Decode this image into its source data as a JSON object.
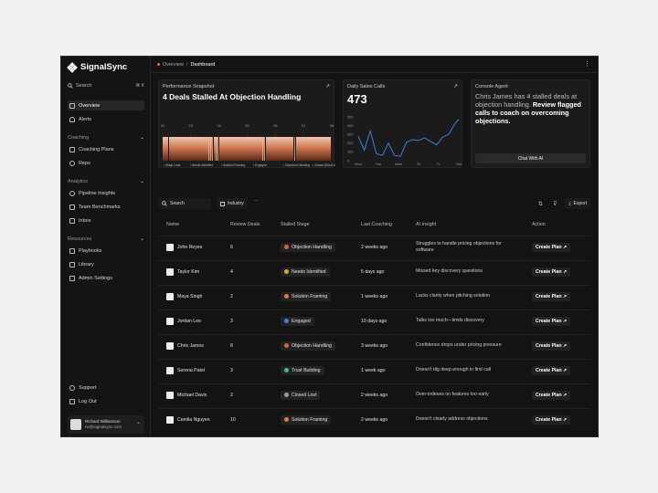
{
  "app": {
    "name": "SignalSync"
  },
  "sidebar": {
    "search_label": "Search",
    "search_shortcut": "⌘ K",
    "main_items": [
      {
        "label": "Overview",
        "icon": "home-icon",
        "active": true
      },
      {
        "label": "Alerts",
        "icon": "bell-icon",
        "active": false
      }
    ],
    "sections": [
      {
        "title": "Coaching",
        "items": [
          {
            "label": "Coaching Plans",
            "icon": "calendar-icon"
          },
          {
            "label": "Reps",
            "icon": "users-icon"
          }
        ]
      },
      {
        "title": "Analytics",
        "items": [
          {
            "label": "Pipeline Insights",
            "icon": "pipeline-icon"
          },
          {
            "label": "Team Benchmarks",
            "icon": "benchmark-icon"
          },
          {
            "label": "Inbox",
            "icon": "inbox-icon"
          }
        ]
      },
      {
        "title": "Resources",
        "items": [
          {
            "label": "Playbooks",
            "icon": "book-icon"
          },
          {
            "label": "Library",
            "icon": "library-icon"
          },
          {
            "label": "Admin Settings",
            "icon": "settings-icon"
          }
        ]
      }
    ],
    "footer_items": [
      {
        "label": "Support",
        "icon": "help-icon"
      },
      {
        "label": "Log Out",
        "icon": "logout-icon"
      }
    ],
    "user": {
      "name": "Richard Williamson",
      "email": "rw@signalsync.com"
    }
  },
  "breadcrumb": {
    "parent": "Overview",
    "separator": "/",
    "current": "Dashboard"
  },
  "performance": {
    "title": "Performance Snapshot",
    "headline": "4 Deals Stalled At Objection Handling",
    "axis_ticks": [
      "02",
      "03",
      "04",
      "05",
      "06",
      "07",
      "08"
    ],
    "stage_labels": [
      "Stage Lead",
      "Needs Identified",
      "Solution Framing",
      "Engaged",
      "Objection Handling",
      "Closed (Won/Lost)"
    ],
    "accent": "#c9714a"
  },
  "daily_calls": {
    "title": "Daily Sales Calls",
    "value": "473",
    "line_color": "#3d7fe0"
  },
  "agent": {
    "title": "Console Agent",
    "text_plain": "Chris James has 4 stalled deals at objection handling. ",
    "text_bold": "Review flagged calls to coach on overcoming objections.",
    "button": "Chat With AI"
  },
  "toolbar": {
    "search": "Search",
    "industry": "Industry",
    "export": "Export"
  },
  "table": {
    "headers": {
      "name": "Name",
      "deals": "Review Deals",
      "stage": "Stalled Stage",
      "coaching": "Last Coaching",
      "insight": "AI Insight",
      "action": "Action"
    },
    "rows": [
      {
        "name": "John Reyes",
        "deals": "6",
        "stage": "Objection Handling",
        "stage_color": "#e0603a",
        "coaching": "2 weeks ago",
        "insight": "Struggles to handle pricing objections for software",
        "action": "Create Plan ↗"
      },
      {
        "name": "Taylor Kim",
        "deals": "4",
        "stage": "Needs Identified",
        "stage_color": "#e0a03a",
        "coaching": "5 days ago",
        "insight": "Missed key discovery questions",
        "action": "Create Plan ↗"
      },
      {
        "name": "Maya Singh",
        "deals": "2",
        "stage": "Solution Framing",
        "stage_color": "#e07a3a",
        "coaching": "1 weeks ago",
        "insight": "Lacks clarity when pitching solution",
        "action": "Create Plan ↗"
      },
      {
        "name": "Jordan Lee",
        "deals": "3",
        "stage": "Engaged",
        "stage_color": "#3d7fe0",
        "coaching": "10 days ago",
        "insight": "Talks too much—limits discovery",
        "action": "Create Plan ↗"
      },
      {
        "name": "Chris James",
        "deals": "8",
        "stage": "Objection Handling",
        "stage_color": "#e0603a",
        "coaching": "3 weeks ago",
        "insight": "Confidence drops under pricing pressure",
        "action": "Create Plan ↗"
      },
      {
        "name": "Serena Patel",
        "deals": "3",
        "stage": "Trust Building",
        "stage_color": "#3dbf7a",
        "coaching": "1 week ago",
        "insight": "Doesn't dig deep enough in first call",
        "action": "Create Plan ↗"
      },
      {
        "name": "Michael Davis",
        "deals": "2",
        "stage": "Closed Lost",
        "stage_color": "#9a9a9a",
        "coaching": "2 weeks ago",
        "insight": "Over-indexes on features too early",
        "action": "Create Plan ↗"
      },
      {
        "name": "Camila Nguyen",
        "deals": "10",
        "stage": "Solution Framing",
        "stage_color": "#e07a3a",
        "coaching": "2 weeks ago",
        "insight": "Doesn't clearly address objections",
        "action": "Create Plan ↗"
      }
    ]
  },
  "chart_data": {
    "type": "line",
    "title": "Daily Sales Calls",
    "categories": [
      "Mon",
      "Tue",
      "Wed",
      "Th",
      "Fr",
      "Sat"
    ],
    "ylim": [
      0,
      500
    ],
    "y_ticks": [
      "500",
      "400",
      "300",
      "200",
      "100",
      "0"
    ],
    "series": [
      {
        "x": [
          0,
          0.3,
          0.6,
          0.9,
          1.2,
          1.5,
          1.8,
          2.1,
          2.4,
          2.7,
          3.0,
          3.3,
          3.6,
          3.9,
          4.2,
          4.5,
          4.8,
          5.0
        ],
        "values": [
          280,
          120,
          340,
          80,
          60,
          200,
          60,
          50,
          210,
          240,
          230,
          260,
          220,
          180,
          270,
          300,
          420,
          470
        ]
      }
    ]
  }
}
